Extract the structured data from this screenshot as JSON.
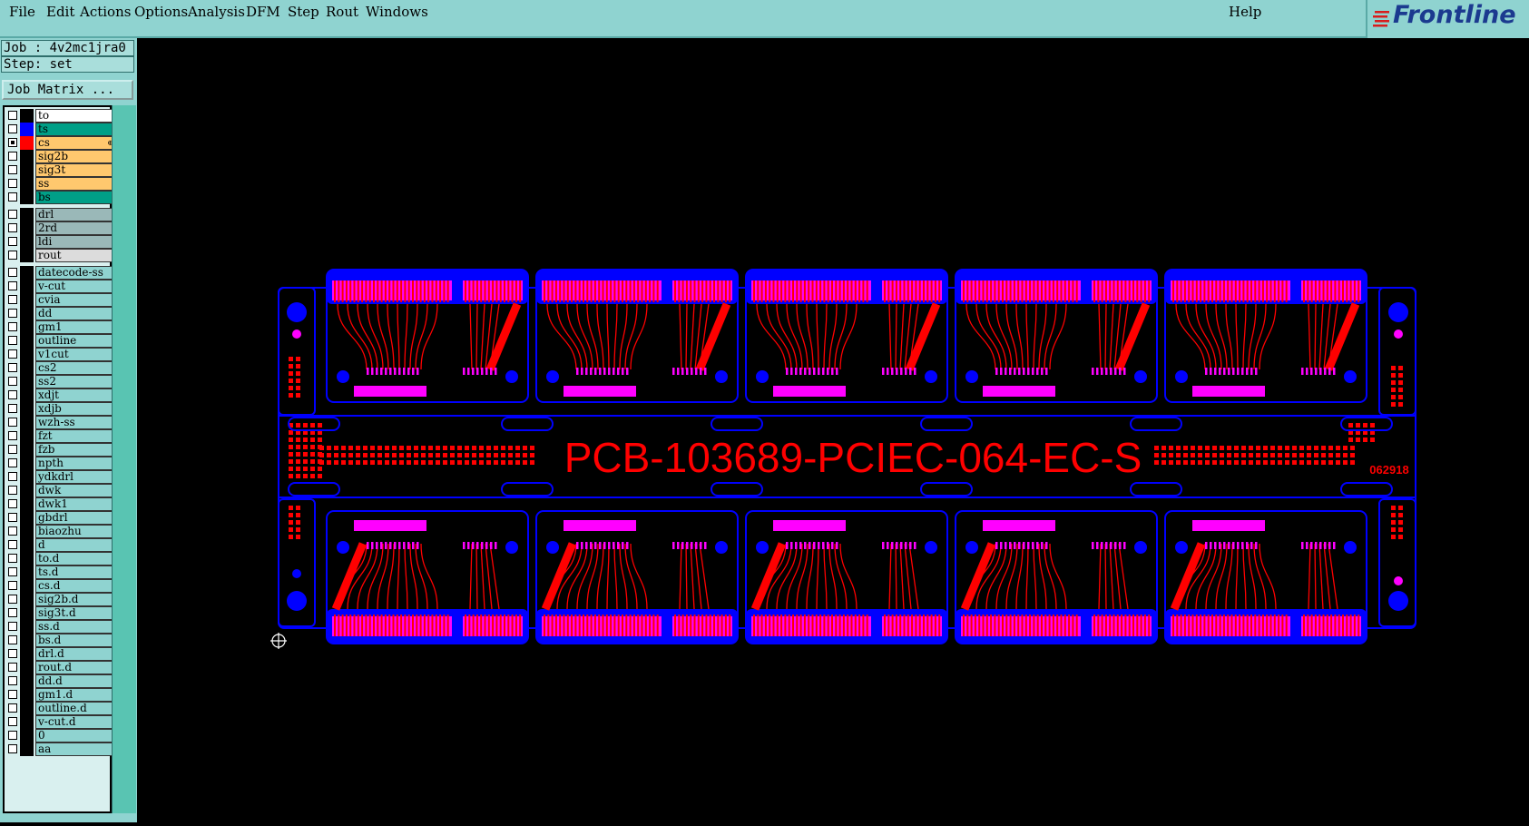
{
  "menu": {
    "items": [
      "File",
      "Edit",
      "Actions",
      "Options",
      "Analysis",
      "DFM",
      "Step",
      "Rout",
      "Windows"
    ],
    "help": "Help"
  },
  "logo": {
    "text": "Frontline"
  },
  "job": {
    "label": "Job : 4v2mc1jra0",
    "step": "Step: set"
  },
  "matrix_button": "Job Matrix ...",
  "layers": [
    {
      "name": "to",
      "color": "#ffffff",
      "swatch": "",
      "active": false
    },
    {
      "name": "ts",
      "color": "#009f87",
      "swatch": "#0000ff",
      "active": false
    },
    {
      "name": "cs",
      "color": "#ffc86e",
      "swatch": "#ff0000",
      "active": true,
      "mark": "⊕"
    },
    {
      "name": "sig2b",
      "color": "#ffc86e",
      "swatch": "",
      "active": false
    },
    {
      "name": "sig3t",
      "color": "#ffc86e",
      "swatch": "",
      "active": false
    },
    {
      "name": "ss",
      "color": "#ffc86e",
      "swatch": "",
      "active": false
    },
    {
      "name": "bs",
      "color": "#009f87",
      "swatch": "",
      "active": false
    },
    {
      "name": "drl",
      "color": "#9ab8b8",
      "swatch": "",
      "active": false,
      "gap": true
    },
    {
      "name": "2rd",
      "color": "#9ab8b8",
      "swatch": "",
      "active": false
    },
    {
      "name": "ldi",
      "color": "#9ab8b8",
      "swatch": "",
      "active": false
    },
    {
      "name": "rout",
      "color": "#dcdcdc",
      "swatch": "",
      "active": false
    },
    {
      "name": "datecode-ss",
      "color": "#8fd3d0",
      "swatch": "",
      "active": false,
      "gap": true
    },
    {
      "name": "v-cut",
      "color": "#8fd3d0",
      "swatch": "",
      "active": false
    },
    {
      "name": "cvia",
      "color": "#8fd3d0",
      "swatch": "",
      "active": false
    },
    {
      "name": "dd",
      "color": "#8fd3d0",
      "swatch": "",
      "active": false
    },
    {
      "name": "gm1",
      "color": "#8fd3d0",
      "swatch": "",
      "active": false
    },
    {
      "name": "outline",
      "color": "#8fd3d0",
      "swatch": "",
      "active": false
    },
    {
      "name": "v1cut",
      "color": "#8fd3d0",
      "swatch": "",
      "active": false
    },
    {
      "name": "cs2",
      "color": "#8fd3d0",
      "swatch": "",
      "active": false
    },
    {
      "name": "ss2",
      "color": "#8fd3d0",
      "swatch": "",
      "active": false
    },
    {
      "name": "xdjt",
      "color": "#8fd3d0",
      "swatch": "",
      "active": false
    },
    {
      "name": "xdjb",
      "color": "#8fd3d0",
      "swatch": "",
      "active": false
    },
    {
      "name": "wzh-ss",
      "color": "#8fd3d0",
      "swatch": "",
      "active": false
    },
    {
      "name": "fzt",
      "color": "#8fd3d0",
      "swatch": "",
      "active": false
    },
    {
      "name": "fzb",
      "color": "#8fd3d0",
      "swatch": "",
      "active": false
    },
    {
      "name": "npth",
      "color": "#8fd3d0",
      "swatch": "",
      "active": false
    },
    {
      "name": "ydkdrl",
      "color": "#8fd3d0",
      "swatch": "",
      "active": false
    },
    {
      "name": "dwk",
      "color": "#8fd3d0",
      "swatch": "",
      "active": false
    },
    {
      "name": "dwk1",
      "color": "#8fd3d0",
      "swatch": "",
      "active": false
    },
    {
      "name": "gbdrl",
      "color": "#8fd3d0",
      "swatch": "",
      "active": false
    },
    {
      "name": "biaozhu",
      "color": "#8fd3d0",
      "swatch": "",
      "active": false
    },
    {
      "name": "d",
      "color": "#8fd3d0",
      "swatch": "",
      "active": false
    },
    {
      "name": "to.d",
      "color": "#8fd3d0",
      "swatch": "",
      "active": false
    },
    {
      "name": "ts.d",
      "color": "#8fd3d0",
      "swatch": "",
      "active": false
    },
    {
      "name": "cs.d",
      "color": "#8fd3d0",
      "swatch": "",
      "active": false
    },
    {
      "name": "sig2b.d",
      "color": "#8fd3d0",
      "swatch": "",
      "active": false
    },
    {
      "name": "sig3t.d",
      "color": "#8fd3d0",
      "swatch": "",
      "active": false
    },
    {
      "name": "ss.d",
      "color": "#8fd3d0",
      "swatch": "",
      "active": false
    },
    {
      "name": "bs.d",
      "color": "#8fd3d0",
      "swatch": "",
      "active": false
    },
    {
      "name": "drl.d",
      "color": "#8fd3d0",
      "swatch": "",
      "active": false
    },
    {
      "name": "rout.d",
      "color": "#8fd3d0",
      "swatch": "",
      "active": false
    },
    {
      "name": "dd.d",
      "color": "#8fd3d0",
      "swatch": "",
      "active": false
    },
    {
      "name": "gm1.d",
      "color": "#8fd3d0",
      "swatch": "",
      "active": false
    },
    {
      "name": "outline.d",
      "color": "#8fd3d0",
      "swatch": "",
      "active": false
    },
    {
      "name": "v-cut.d",
      "color": "#8fd3d0",
      "swatch": "",
      "active": false
    },
    {
      "name": "0",
      "color": "#8fd3d0",
      "swatch": "",
      "active": false
    },
    {
      "name": "aa",
      "color": "#8fd3d0",
      "swatch": "",
      "active": false
    }
  ],
  "board": {
    "label": "PCB-103689-PCIEC-064-EC-S",
    "datecode": "062918",
    "colors": {
      "ts": "#0000ff",
      "cs": "#ff0000",
      "overlap": "#ff00ff"
    }
  }
}
